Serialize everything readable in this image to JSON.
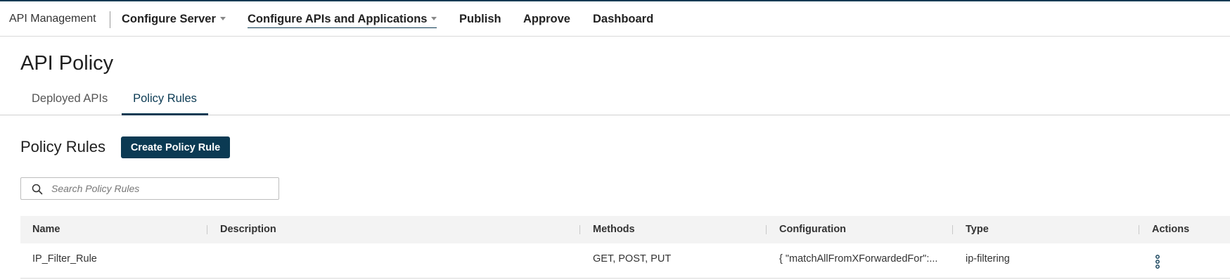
{
  "header": {
    "brand": "API Management",
    "nav": [
      {
        "label": "Configure Server",
        "has_menu": true
      },
      {
        "label": "Configure APIs and Applications",
        "has_menu": true,
        "active": true
      },
      {
        "label": "Publish"
      },
      {
        "label": "Approve"
      },
      {
        "label": "Dashboard"
      }
    ]
  },
  "page": {
    "title": "API Policy",
    "tabs": [
      {
        "label": "Deployed APIs",
        "active": false
      },
      {
        "label": "Policy Rules",
        "active": true
      }
    ]
  },
  "section": {
    "title": "Policy Rules",
    "create_button": "Create Policy Rule"
  },
  "search": {
    "placeholder": "Search Policy Rules",
    "value": "",
    "icon": "search-icon"
  },
  "table": {
    "columns": [
      "Name",
      "Description",
      "Methods",
      "Configuration",
      "Type",
      "Actions"
    ],
    "rows": [
      {
        "name": "IP_Filter_Rule",
        "description": "",
        "methods": "GET, POST, PUT",
        "configuration": "{ \"matchAllFromXForwardedFor\":...",
        "type": "ip-filtering",
        "actions_icon": "more-vertical-icon"
      }
    ]
  },
  "colors": {
    "primary": "#0b3a53",
    "header_bg": "#f3f3f3",
    "text": "#1f1f1f"
  }
}
